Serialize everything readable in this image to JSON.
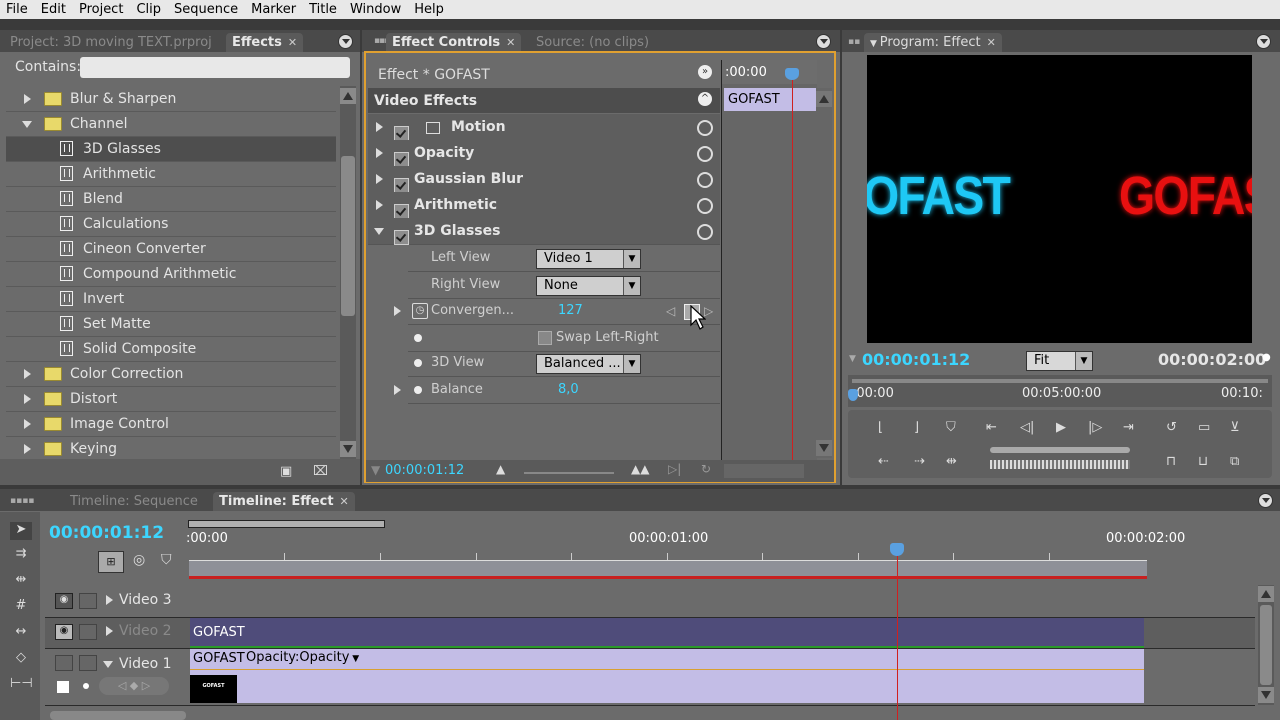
{
  "menu": [
    "File",
    "Edit",
    "Project",
    "Clip",
    "Sequence",
    "Marker",
    "Title",
    "Window",
    "Help"
  ],
  "effects_panel": {
    "tab_project": "Project: 3D moving TEXT.prproj",
    "tab_effects": "Effects",
    "contains_label": "Contains:",
    "items": [
      {
        "label": "Blur & Sharpen",
        "type": "folder",
        "expanded": false
      },
      {
        "label": "Channel",
        "type": "folder",
        "expanded": true
      },
      {
        "label": "3D Glasses",
        "type": "effect",
        "selected": true
      },
      {
        "label": "Arithmetic",
        "type": "effect"
      },
      {
        "label": "Blend",
        "type": "effect"
      },
      {
        "label": "Calculations",
        "type": "effect"
      },
      {
        "label": "Cineon Converter",
        "type": "effect"
      },
      {
        "label": "Compound Arithmetic",
        "type": "effect"
      },
      {
        "label": "Invert",
        "type": "effect"
      },
      {
        "label": "Set Matte",
        "type": "effect"
      },
      {
        "label": "Solid Composite",
        "type": "effect"
      },
      {
        "label": "Color Correction",
        "type": "folder",
        "expanded": false
      },
      {
        "label": "Distort",
        "type": "folder",
        "expanded": false
      },
      {
        "label": "Image Control",
        "type": "folder",
        "expanded": false
      },
      {
        "label": "Keying",
        "type": "folder",
        "expanded": false
      }
    ]
  },
  "effect_controls": {
    "tab_active": "Effect Controls",
    "tab_source": "Source: (no clips)",
    "header": "Effect * GOFAST",
    "section": "Video Effects",
    "mini_time": ":00:00",
    "mini_clip": "GOFAST",
    "effects": [
      "Motion",
      "Opacity",
      "Gaussian Blur",
      "Arithmetic",
      "3D Glasses"
    ],
    "params": {
      "left_view_label": "Left View",
      "left_view_value": "Video 1",
      "right_view_label": "Right View",
      "right_view_value": "None",
      "convergence_label": "Convergen...",
      "convergence_value": "127",
      "swap_label": "Swap Left-Right",
      "view3d_label": "3D View",
      "view3d_value": "Balanced ...",
      "balance_label": "Balance",
      "balance_value": "8,0"
    },
    "timecode": "00:00:01:12"
  },
  "program": {
    "tab": "Program: Effect",
    "text_left": "OFAST",
    "text_right": "GOFAS",
    "timecode": "00:00:01:12",
    "fit": "Fit",
    "duration": "00:00:02:00",
    "ruler": [
      ":00:00",
      "00:05:00:00",
      "00:10:"
    ]
  },
  "timeline": {
    "tab_inactive": "Timeline: Sequence",
    "tab_active": "Timeline: Effect",
    "timecode": "00:00:01:12",
    "ruler": [
      ":00:00",
      "00:00:01:00",
      "00:00:02:00"
    ],
    "tracks": [
      {
        "name": "Video 3",
        "clip": ""
      },
      {
        "name": "Video 2",
        "clip": "GOFAST"
      },
      {
        "name": "Video 1",
        "clip": "GOFAST",
        "clip_fx": "Opacity:Opacity"
      }
    ],
    "thumb_text": "GOFAST"
  },
  "colors": {
    "cyan": "#3cd6ff",
    "accent": "#e0a030",
    "playhead": "#d02020"
  }
}
